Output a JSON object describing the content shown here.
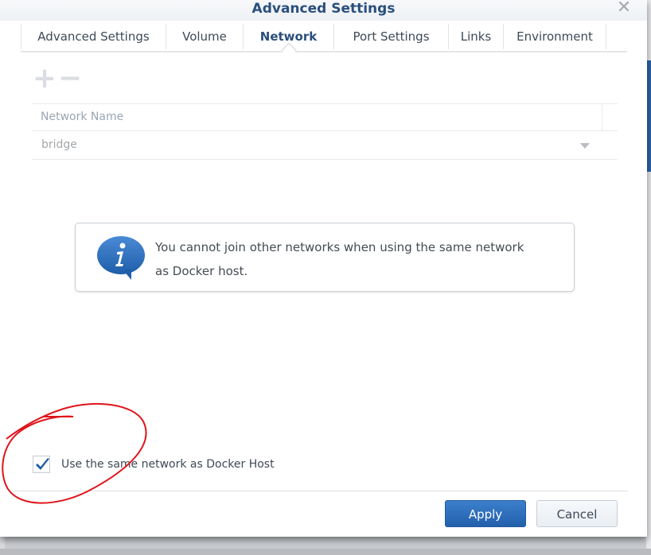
{
  "dialog": {
    "title": "Advanced Settings",
    "close_icon": "close-icon"
  },
  "tabs": [
    {
      "label": "Advanced Settings",
      "active": false
    },
    {
      "label": "Volume",
      "active": false
    },
    {
      "label": "Network",
      "active": true
    },
    {
      "label": "Port Settings",
      "active": false
    },
    {
      "label": "Links",
      "active": false
    },
    {
      "label": "Environment",
      "active": false
    }
  ],
  "toolbar": {
    "add_label": "+",
    "remove_label": "−",
    "add_icon": "plus-icon",
    "remove_icon": "minus-icon"
  },
  "grid": {
    "columns": [
      "Network Name"
    ],
    "rows": [
      {
        "network_name": "bridge"
      }
    ]
  },
  "info": {
    "icon": "info-icon",
    "message": "You cannot join other networks when using the same network as Docker host."
  },
  "checkbox": {
    "label": "Use the same network as Docker Host",
    "checked": true
  },
  "footer": {
    "apply_label": "Apply",
    "cancel_label": "Cancel"
  },
  "colors": {
    "accent": "#2a4f7c",
    "primary_button": "#2d6bbd",
    "annotation": "#e0141b"
  }
}
